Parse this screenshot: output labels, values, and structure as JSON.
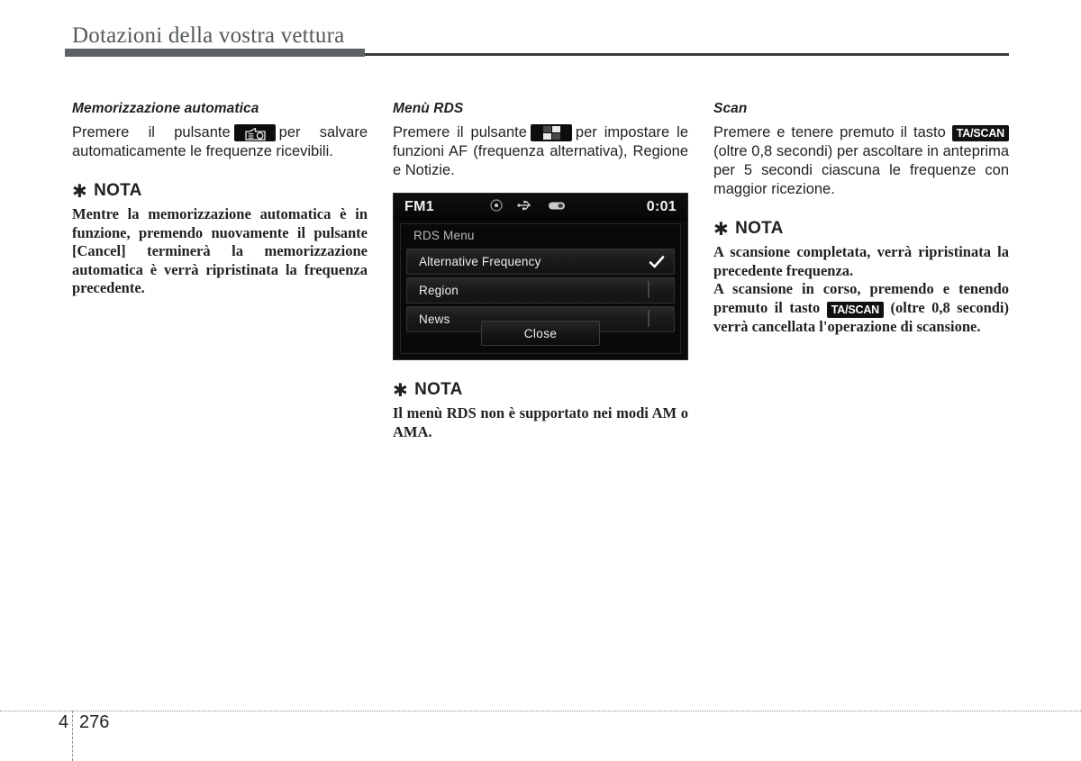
{
  "header": {
    "title": "Dotazioni della vostra vettura"
  },
  "columns": {
    "left": {
      "heading": "Memorizzazione automatica",
      "body_before_icon": "Premere il pulsante",
      "icon": "radio-auto-store-icon",
      "body_after_icon": "per salvare automaticamente le frequenze ricevibili.",
      "nota": {
        "title": "NOTA",
        "asterisk": "✱",
        "text": "Mentre la memorizzazione automatica è in funzione, premendo nuovamente il pulsante [Cancel] terminerà la memorizzazione automatica è verrà ripristinata la frequenza precedente."
      }
    },
    "middle": {
      "heading": "Menù RDS",
      "body_before_icon": "Premere il pulsante",
      "icon": "menu-grid-icon",
      "body_after_icon": "per impostare le funzioni AF (frequenza alternativa), Regione e Notizie.",
      "screen": {
        "source": "FM1",
        "time": "0:01",
        "status_icons": [
          "disc-icon",
          "usb-icon",
          "aux-icon"
        ],
        "panel_title": "RDS Menu",
        "rows": [
          {
            "label": "Alternative Frequency",
            "control": "checkmark",
            "checked": true
          },
          {
            "label": "Region",
            "control": "checkbox",
            "checked": false
          },
          {
            "label": "News",
            "control": "checkbox",
            "checked": false
          }
        ],
        "close_label": "Close"
      },
      "nota": {
        "title": "NOTA",
        "asterisk": "✱",
        "text": "Il menù RDS non è supportato nei modi AM o AMA."
      }
    },
    "right": {
      "heading": "Scan",
      "body_part1": "Premere e tenere premuto il tasto",
      "badge": "TA/SCAN",
      "body_part2": "(oltre 0,8 secondi) per ascoltare in anteprima per 5 secondi ciascuna le frequenze con maggior ricezione.",
      "nota": {
        "title": "NOTA",
        "asterisk": "✱",
        "paragraph1": "A scansione completata, verrà ripristinata la precedente frequenza.",
        "p2_part1": "A scansione in corso, premendo e tenendo premuto il tasto",
        "p2_badge": "TA/SCAN",
        "p2_part2": "(oltre 0,8 secondi) verrà cancellata l'operazione di scansione."
      }
    }
  },
  "footer": {
    "chapter": "4",
    "page": "276"
  },
  "colors": {
    "rule_thick": "#5f6264",
    "rule_thin": "#3b3d3f",
    "title_gray": "#54585a",
    "body_ink": "#231f20",
    "screen_bg": "#0a0a0a"
  }
}
